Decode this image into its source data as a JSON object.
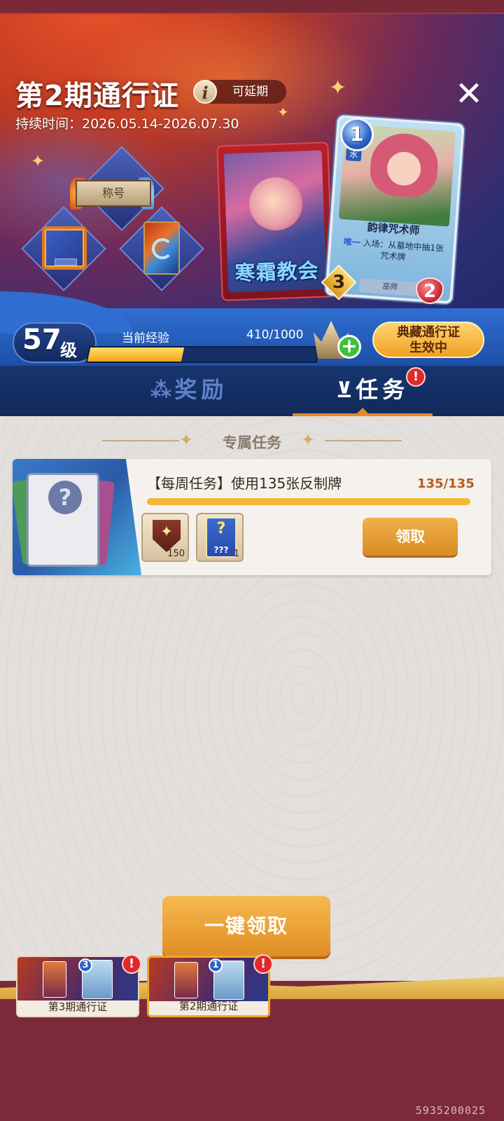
{
  "header": {
    "title": "第2期通行证",
    "info_icon": "i",
    "extend_badge": "可延期",
    "duration": "持续时间：2026.05.14-2026.07.30",
    "close_icon": "✕"
  },
  "rewards_preview": {
    "title_ribbon": "称号",
    "pack_name": "寒霜教会",
    "card": {
      "cost": "1",
      "element": "水",
      "faction": "寒霜教会",
      "name": "韵律咒术师",
      "desc_keyword": "唯一",
      "desc": "入场：从墓地中抽1张咒术牌",
      "race": "巫师",
      "attack": "3",
      "health": "2"
    }
  },
  "level": {
    "number": "57",
    "unit": "级",
    "exp_label": "当前经验",
    "exp_value": "410/1000",
    "exp_current": 410,
    "exp_max": 1000,
    "plus_icon": "+",
    "premium_button": [
      "典藏通行证",
      "生效中"
    ]
  },
  "tabs": {
    "rewards": "奖励",
    "tasks": "任务",
    "alert": "!"
  },
  "section": {
    "title": "专属任务"
  },
  "task": {
    "name": "【每周任务】使用135张反制牌",
    "progress_text": "135/135",
    "progress_current": 135,
    "progress_max": 135,
    "rewards": [
      {
        "icon": "emblem-icon",
        "count": "150"
      },
      {
        "icon": "mystery-card-icon",
        "label": "???",
        "count": "1"
      }
    ],
    "claim_button": "领取"
  },
  "claim_all_button": "一键领取",
  "pass_tabs": [
    {
      "label": "第3期通行证",
      "badge": "3",
      "alert": "!"
    },
    {
      "label": "第2期通行证",
      "badge": "1",
      "alert": "!"
    }
  ],
  "watermark": "5935200025",
  "colors": {
    "accent_orange": "#e8942a",
    "tab_bar": "#17356e",
    "alert_red": "#e02a2a",
    "progress_yellow": "#f5b637"
  }
}
